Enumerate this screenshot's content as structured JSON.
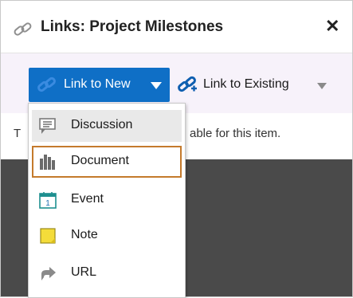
{
  "dialog": {
    "title": "Links: Project Milestones",
    "close_label": "✕"
  },
  "toolbar": {
    "link_new_label": "Link to New",
    "link_existing_label": "Link to Existing"
  },
  "empty_message": {
    "prefix": "T",
    "suffix": "able for this item."
  },
  "menu": {
    "items": [
      {
        "label": "Discussion",
        "icon": "discussion-icon"
      },
      {
        "label": "Document",
        "icon": "document-icon"
      },
      {
        "label": "Event",
        "icon": "calendar-icon"
      },
      {
        "label": "Note",
        "icon": "note-icon"
      },
      {
        "label": "URL",
        "icon": "url-icon"
      }
    ],
    "hovered_item": "Discussion",
    "highlighted_item": "Document"
  },
  "colors": {
    "primary_button": "#0f6fc6",
    "highlight_border": "#c47a2c",
    "body_background": "#f7f2fa",
    "backdrop": "#4a4a4a"
  }
}
